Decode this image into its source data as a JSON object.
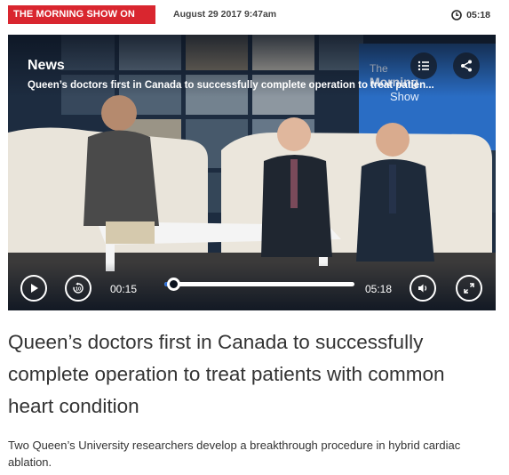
{
  "header": {
    "show_name": "THE MORNING SHOW ON CKWS",
    "date": "August 29 2017 9:47am",
    "duration": "05:18",
    "duration_icon": "clock-icon"
  },
  "player": {
    "category": "News",
    "video_title": "Queen’s doctors first in Canada to successfully complete operation to treat patien...",
    "current_time": "00:15",
    "total_time": "05:18",
    "progress_fraction": 0.047,
    "icons": {
      "playlist": "list-icon",
      "share": "share-icon",
      "play": "play-icon",
      "rewind": "rewind-10-icon",
      "volume": "volume-icon",
      "fullscreen": "fullscreen-icon"
    },
    "rewind_seconds": "10",
    "studio_logo_lines": [
      "The",
      "Morning",
      "Show"
    ]
  },
  "article": {
    "headline": "Queen’s doctors first in Canada to successfully complete operation to treat patients with common heart condition",
    "summary": "Two Queen’s University researchers develop a breakthrough procedure in hybrid cardiac ablation."
  },
  "colors": {
    "brand_red": "#d9262f",
    "progress_blue": "#2f6fd6",
    "text": "#333333"
  }
}
